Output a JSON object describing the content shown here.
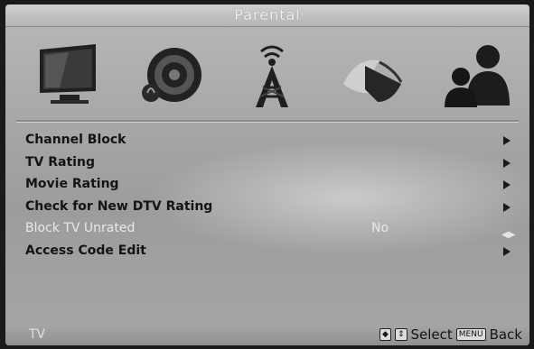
{
  "title": "Parental",
  "menu": {
    "channel_block": "Channel Block",
    "tv_rating": "TV Rating",
    "movie_rating": "Movie Rating",
    "check_dtv": "Check for New DTV Rating",
    "block_unrated": "Block TV Unrated",
    "block_unrated_value": "No",
    "access_code": "Access Code Edit"
  },
  "footer": {
    "source": "TV",
    "nav_glyph": "◆",
    "updown_glyph": "⇕",
    "select_label": "Select",
    "menu_key": "MENU",
    "back_label": "Back"
  },
  "icons": [
    "tv-picture-icon",
    "sound-speaker-icon",
    "channel-antenna-icon",
    "setup-satellite-icon",
    "parental-users-icon"
  ],
  "colors": {
    "background": "#a8a8a8",
    "text": "#141414",
    "disabled_text": "#e8e8e8"
  }
}
